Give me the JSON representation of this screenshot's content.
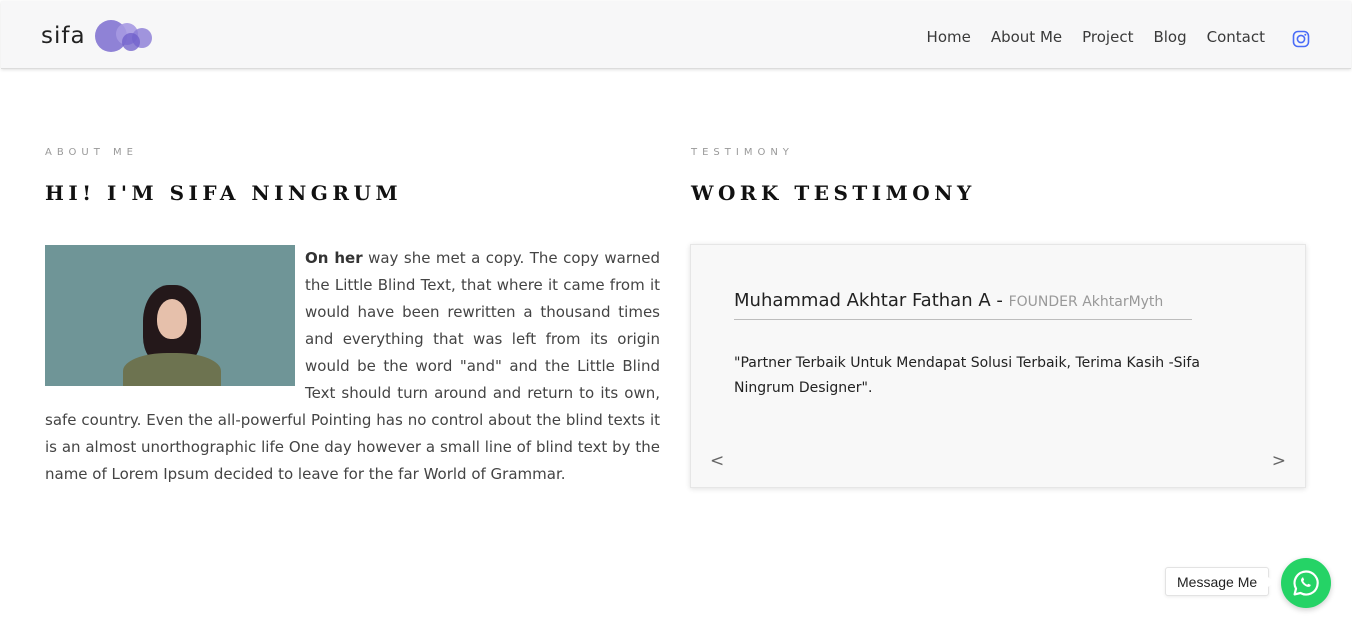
{
  "brand": {
    "name": "sifa",
    "logo_icon": "bubbles-logo-icon"
  },
  "nav": {
    "items": [
      "Home",
      "About Me",
      "Project",
      "Blog",
      "Contact"
    ],
    "social_icon": "instagram-icon"
  },
  "about": {
    "eyebrow": "ABOUT ME",
    "heading": "HI! I'M SIFA NINGRUM",
    "lead_bold": "On her",
    "body": " way she met a copy. The copy warned the Little Blind Text, that where it came from it would have been rewritten a thousand times and everything that was left from its origin would be the word \"and\" and the Little Blind Text should turn around and return to its own, safe country. Even the all-powerful Pointing has no control about the blind texts it is an almost unorthographic life One day however a small line of blind text by the name of Lorem Ipsum decided to leave for the far World of Grammar."
  },
  "testimony": {
    "eyebrow": "TESTIMONY",
    "heading": "WORK TESTIMONY",
    "name": "Muhammad Akhtar Fathan A - ",
    "role": "FOUNDER AkhtarMyth",
    "quote": "\"Partner Terbaik Untuk Mendapat Solusi Terbaik, Terima Kasih -Sifa Ningrum Designer\".",
    "prev": "<",
    "next": ">"
  },
  "chat": {
    "label": "Message Me",
    "icon": "whatsapp-icon"
  },
  "colors": {
    "accent_logo": "#8878d4",
    "whatsapp": "#25d366",
    "instagram": "#4a6cf7"
  }
}
